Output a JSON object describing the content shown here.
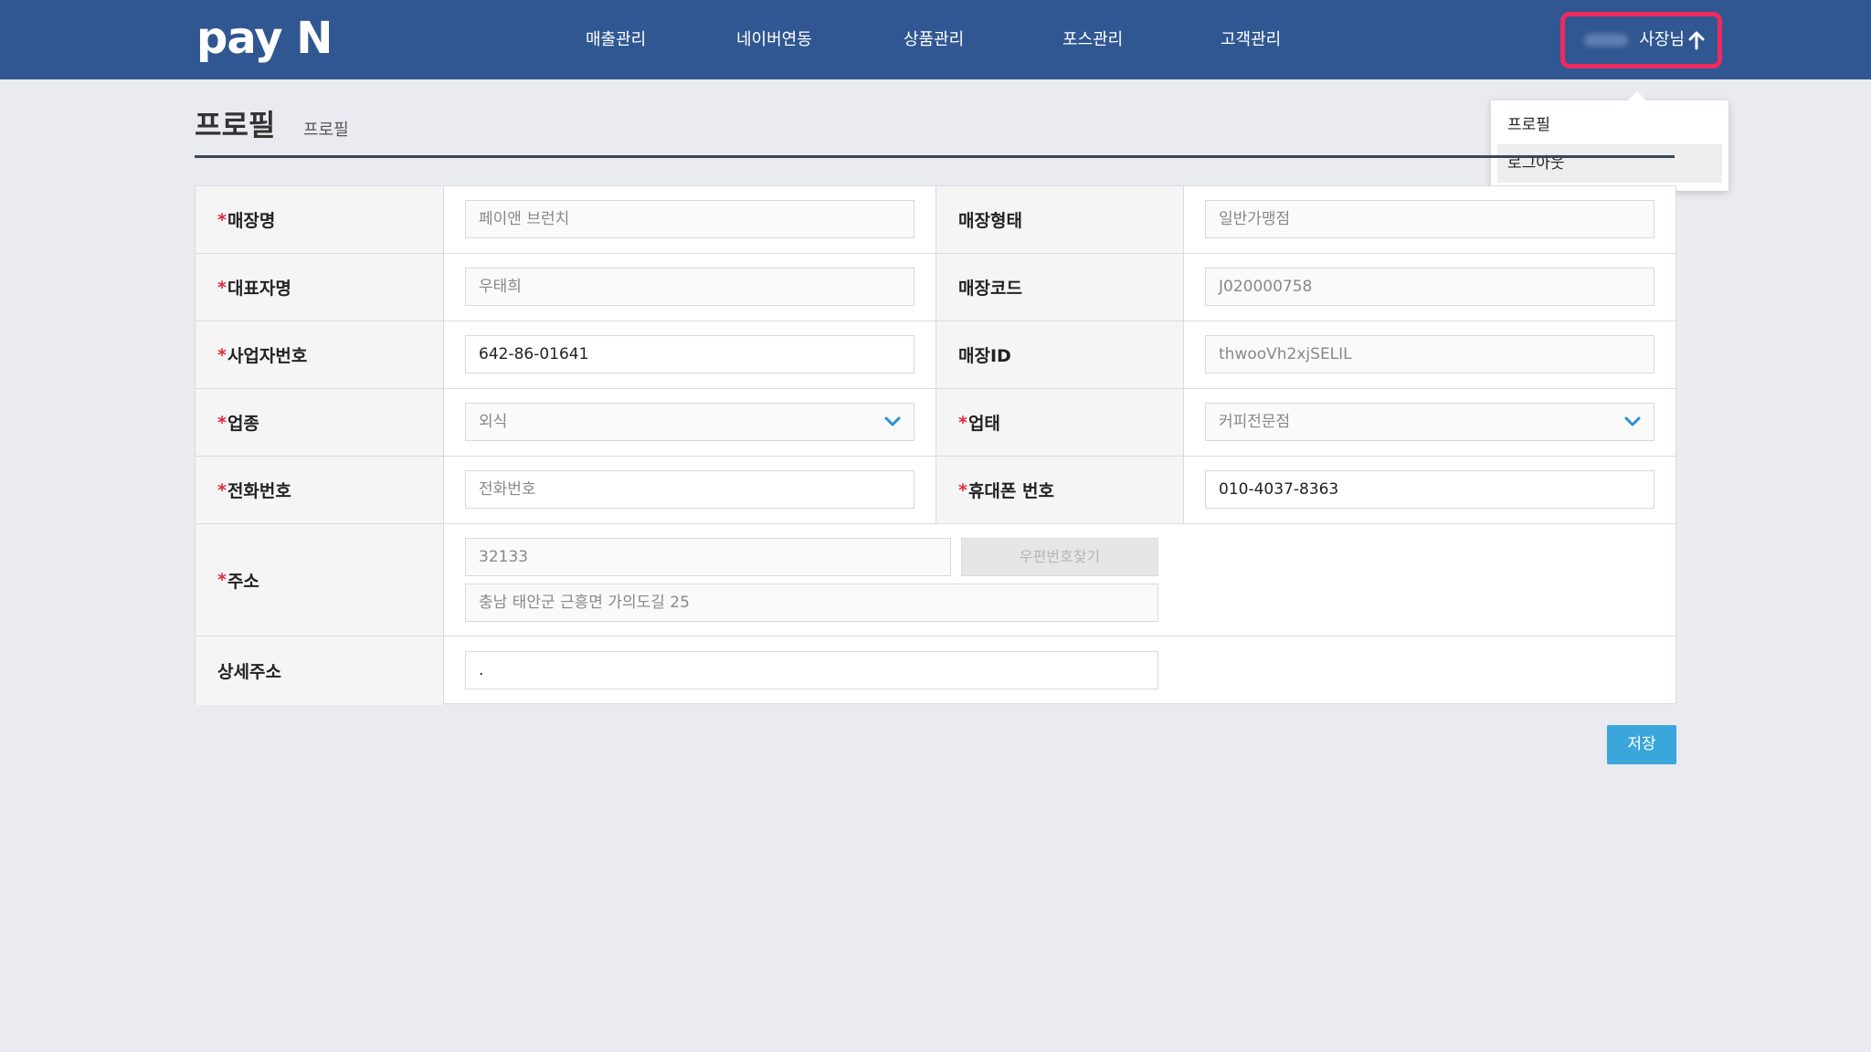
{
  "header": {
    "logo": "pay N",
    "nav": [
      "매출관리",
      "네이버연동",
      "상품관리",
      "포스관리",
      "고객관리"
    ],
    "user_label": "사장님"
  },
  "dropdown": {
    "items": [
      "프로필",
      "로그아웃"
    ]
  },
  "page": {
    "title": "프로필",
    "subtitle": "프로필"
  },
  "form": {
    "store_name": {
      "label": "매장명",
      "required": "*",
      "value": "페이앤 브런치"
    },
    "store_type": {
      "label": "매장형태",
      "value": "일반가맹점"
    },
    "owner_name": {
      "label": "대표자명",
      "required": "*",
      "value": "우태희"
    },
    "store_code": {
      "label": "매장코드",
      "value": "J020000758"
    },
    "biz_number": {
      "label": "사업자번호",
      "required": "*",
      "value": "642-86-01641"
    },
    "store_id": {
      "label": "매장ID",
      "value": "thwooVh2xjSELIL"
    },
    "industry": {
      "label": "업종",
      "required": "*",
      "value": "외식"
    },
    "business": {
      "label": "업태",
      "required": "*",
      "value": "커피전문점"
    },
    "phone": {
      "label": "전화번호",
      "required": "*",
      "placeholder": "전화번호"
    },
    "mobile": {
      "label": "휴대폰 번호",
      "required": "*",
      "value": "010-4037-8363"
    },
    "address": {
      "label": "주소",
      "required": "*",
      "zipcode": "32133",
      "find_button": "우편번호찾기",
      "line1": "충남 태안군 근흥면 가의도길 25"
    },
    "detail_address": {
      "label": "상세주소",
      "value": "."
    }
  },
  "save_label": "저장",
  "colors": {
    "header": "#305791",
    "highlight": "#ee2a5e",
    "required": "#e6283a",
    "save": "#3aa6dc"
  }
}
